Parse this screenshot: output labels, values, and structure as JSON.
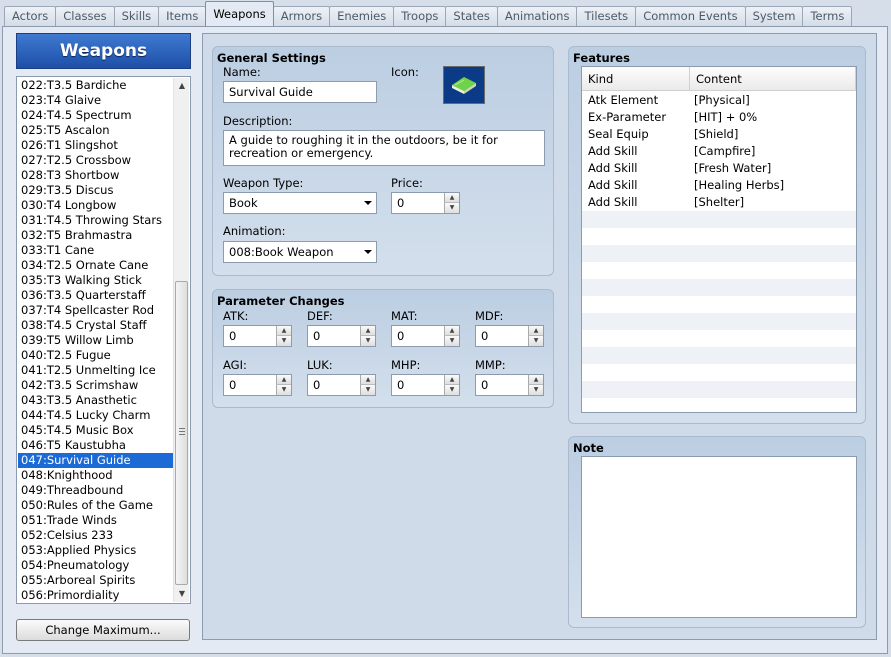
{
  "tabs": [
    "Actors",
    "Classes",
    "Skills",
    "Items",
    "Weapons",
    "Armors",
    "Enemies",
    "Troops",
    "States",
    "Animations",
    "Tilesets",
    "Common Events",
    "System",
    "Terms"
  ],
  "active_tab": 4,
  "list": {
    "title": "Weapons",
    "items": [
      "022:T3.5 Bardiche",
      "023:T4 Glaive",
      "024:T4.5 Spectrum",
      "025:T5 Ascalon",
      "026:T1 Slingshot",
      "027:T2.5 Crossbow",
      "028:T3 Shortbow",
      "029:T3.5 Discus",
      "030:T4 Longbow",
      "031:T4.5 Throwing Stars",
      "032:T5 Brahmastra",
      "033:T1 Cane",
      "034:T2.5 Ornate Cane",
      "035:T3 Walking Stick",
      "036:T3.5 Quarterstaff",
      "037:T4 Spellcaster Rod",
      "038:T4.5 Crystal Staff",
      "039:T5 Willow Limb",
      "040:T2.5 Fugue",
      "041:T2.5 Unmelting Ice",
      "042:T3.5 Scrimshaw",
      "043:T3.5 Anasthetic",
      "044:T4.5 Lucky Charm",
      "045:T4.5 Music Box",
      "046:T5 Kaustubha",
      "047:Survival Guide",
      "048:Knighthood",
      "049:Threadbound",
      "050:Rules of the Game",
      "051:Trade Winds",
      "052:Celsius 233",
      "053:Applied Physics",
      "054:Pneumatology",
      "055:Arboreal Spirits",
      "056:Primordiality"
    ],
    "selected_index": 25,
    "change_maximum_label": "Change Maximum..."
  },
  "general": {
    "title": "General Settings",
    "name_label": "Name:",
    "name_value": "Survival Guide",
    "icon_label": "Icon:",
    "description_label": "Description:",
    "description_value": "A guide to roughing it in the outdoors, be it for recreation or emergency.",
    "weapon_type_label": "Weapon Type:",
    "weapon_type_value": "Book",
    "price_label": "Price:",
    "price_value": "0",
    "animation_label": "Animation:",
    "animation_value": "008:Book Weapon"
  },
  "params": {
    "title": "Parameter Changes",
    "items": [
      {
        "label": "ATK:",
        "value": "0"
      },
      {
        "label": "DEF:",
        "value": "0"
      },
      {
        "label": "MAT:",
        "value": "0"
      },
      {
        "label": "MDF:",
        "value": "0"
      },
      {
        "label": "AGI:",
        "value": "0"
      },
      {
        "label": "LUK:",
        "value": "0"
      },
      {
        "label": "MHP:",
        "value": "0"
      },
      {
        "label": "MMP:",
        "value": "0"
      }
    ]
  },
  "features": {
    "title": "Features",
    "col_kind": "Kind",
    "col_content": "Content",
    "rows": [
      {
        "kind": "Atk Element",
        "content": "[Physical]"
      },
      {
        "kind": "Ex-Parameter",
        "content": "[HIT] + 0%"
      },
      {
        "kind": "Seal Equip",
        "content": "[Shield]"
      },
      {
        "kind": "Add Skill",
        "content": "[Campfire]"
      },
      {
        "kind": "Add Skill",
        "content": "[Fresh Water]"
      },
      {
        "kind": "Add Skill",
        "content": "[Healing Herbs]"
      },
      {
        "kind": "Add Skill",
        "content": "[Shelter]"
      }
    ]
  },
  "note": {
    "title": "Note",
    "value": ""
  },
  "icons": {
    "weapon_icon": "green-book-icon",
    "scroll_up": "chevron-up-icon",
    "scroll_down": "chevron-down-icon"
  }
}
